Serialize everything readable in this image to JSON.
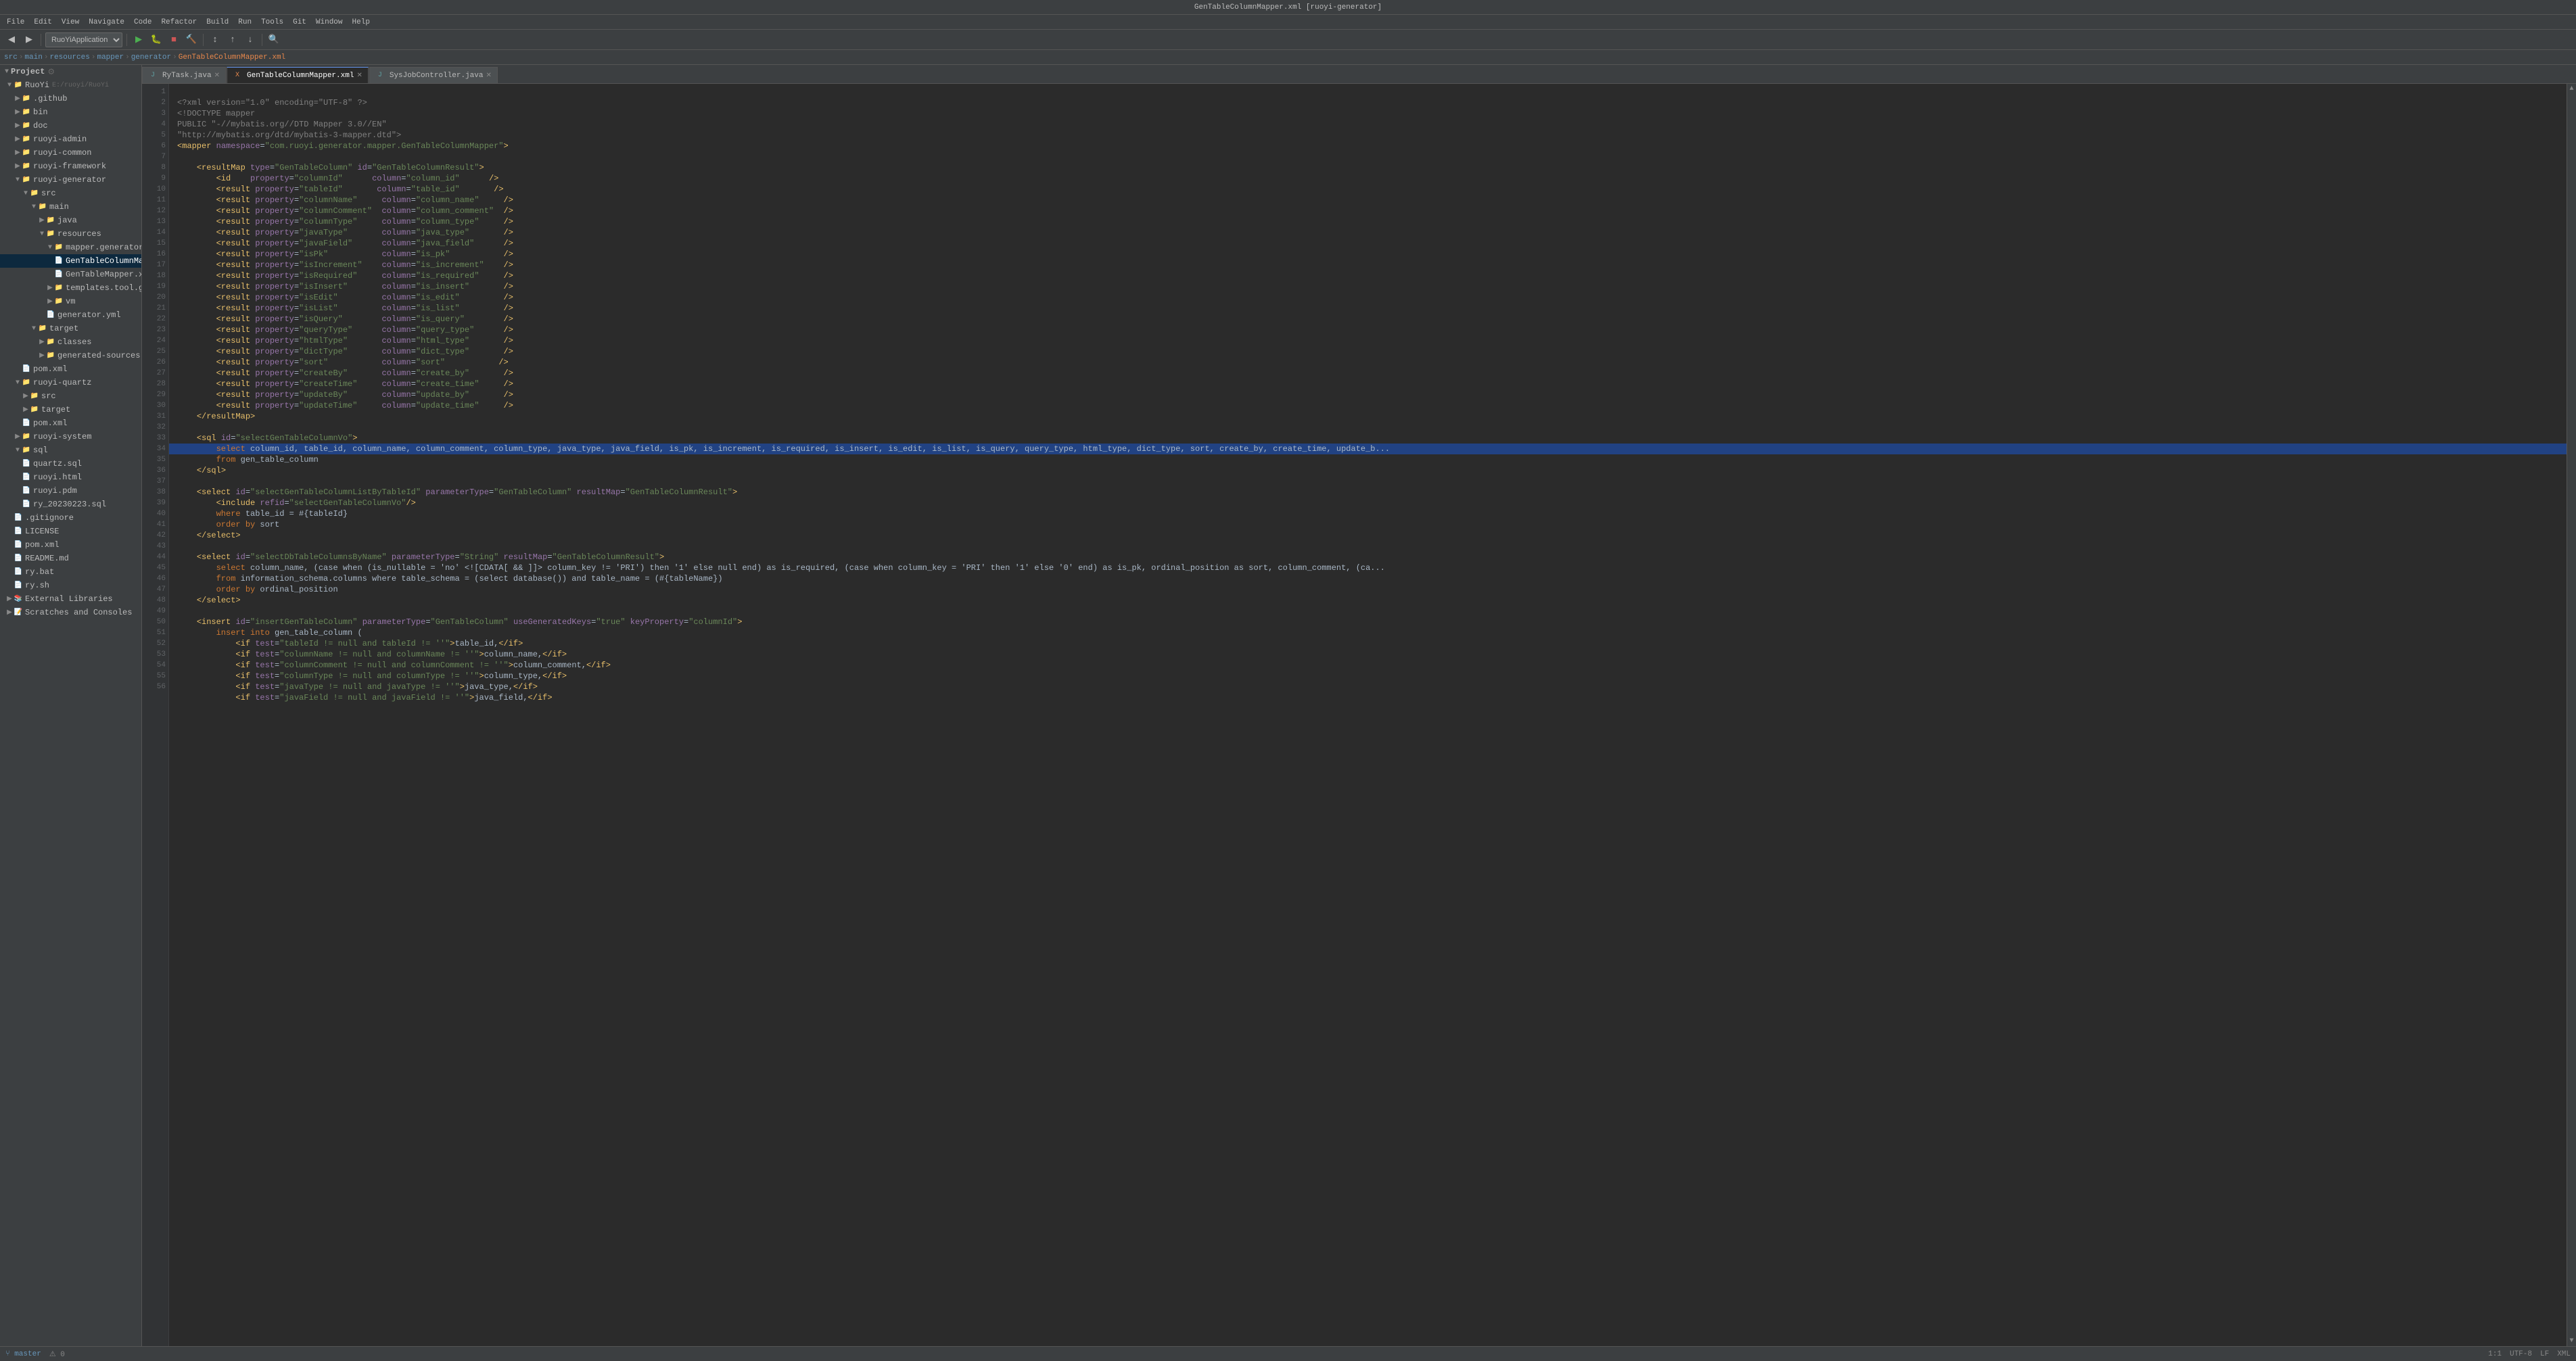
{
  "titleBar": {
    "text": "GenTableColumnMapper.xml [ruoyi-generator]"
  },
  "menuBar": {
    "items": [
      "File",
      "Edit",
      "View",
      "Navigate",
      "Code",
      "Refactor",
      "Build",
      "Run",
      "Tools",
      "Git",
      "Window",
      "Help"
    ]
  },
  "toolbar": {
    "appSelector": "RuoYiApplication",
    "runBtn": "▶",
    "debugBtn": "🐛",
    "stopBtn": "■"
  },
  "breadcrumb": {
    "parts": [
      "src",
      "main",
      "resources",
      "mapper",
      "generator",
      "GenTableColumnMapper.xml"
    ]
  },
  "tabs": [
    {
      "label": "RyTask.java",
      "active": false,
      "modified": false
    },
    {
      "label": "GenTableColumnMapper.xml",
      "active": true,
      "modified": false
    },
    {
      "label": "SysJobController.java",
      "active": false,
      "modified": false
    }
  ],
  "sidebar": {
    "project_label": "Project",
    "tree": [
      {
        "level": 0,
        "icon": "folder",
        "label": "RuoYi",
        "path": "E:/ruoyi/RuoYi",
        "expanded": true
      },
      {
        "level": 1,
        "icon": "folder",
        "label": "github",
        "expanded": false
      },
      {
        "level": 1,
        "icon": "folder",
        "label": "bin",
        "expanded": false
      },
      {
        "level": 1,
        "icon": "folder",
        "label": "doc",
        "expanded": false
      },
      {
        "level": 1,
        "icon": "folder",
        "label": "ruoyi-admin",
        "expanded": false
      },
      {
        "level": 1,
        "icon": "folder",
        "label": "ruoyi-common",
        "expanded": false
      },
      {
        "level": 1,
        "icon": "folder",
        "label": "ruoyi-framework",
        "expanded": false
      },
      {
        "level": 1,
        "icon": "folder",
        "label": "ruoyi-generator",
        "expanded": true
      },
      {
        "level": 2,
        "icon": "folder",
        "label": "src",
        "expanded": true
      },
      {
        "level": 3,
        "icon": "folder",
        "label": "main",
        "expanded": true
      },
      {
        "level": 4,
        "icon": "folder",
        "label": "java",
        "expanded": false
      },
      {
        "level": 4,
        "icon": "folder",
        "label": "resources",
        "expanded": true
      },
      {
        "level": 5,
        "icon": "folder",
        "label": "mapper.generator",
        "expanded": true
      },
      {
        "level": 6,
        "icon": "xml",
        "label": "GenTableColumnMapper.xml",
        "selected": true
      },
      {
        "level": 6,
        "icon": "xml",
        "label": "GenTableMapper.xml"
      },
      {
        "level": 5,
        "icon": "folder",
        "label": "templates.tool.gen",
        "expanded": false
      },
      {
        "level": 5,
        "icon": "folder",
        "label": "vm",
        "expanded": false
      },
      {
        "level": 5,
        "icon": "yml",
        "label": "generator.yml"
      },
      {
        "level": 2,
        "icon": "folder",
        "label": "target",
        "expanded": true
      },
      {
        "level": 3,
        "icon": "folder",
        "label": "classes",
        "expanded": false
      },
      {
        "level": 3,
        "icon": "folder",
        "label": "generated-sources",
        "expanded": false
      },
      {
        "level": 2,
        "icon": "pom",
        "label": "pom.xml"
      },
      {
        "level": 1,
        "icon": "folder",
        "label": "ruoyi-quartz",
        "expanded": true
      },
      {
        "level": 2,
        "icon": "folder",
        "label": "src",
        "expanded": false
      },
      {
        "level": 2,
        "icon": "folder",
        "label": "target",
        "expanded": false
      },
      {
        "level": 2,
        "icon": "pom",
        "label": "pom.xml"
      },
      {
        "level": 1,
        "icon": "folder",
        "label": "ruoyi-system",
        "expanded": false
      },
      {
        "level": 1,
        "icon": "folder",
        "label": "sql",
        "expanded": true
      },
      {
        "level": 2,
        "icon": "sql",
        "label": "quartz.sql"
      },
      {
        "level": 2,
        "icon": "html",
        "label": "ruoyi.html"
      },
      {
        "level": 2,
        "icon": "sql",
        "label": "ruoyi.pdm"
      },
      {
        "level": 2,
        "icon": "sql",
        "label": "ry_20230223.sql"
      },
      {
        "level": 1,
        "icon": "folder",
        "label": ".gitignore"
      },
      {
        "level": 1,
        "icon": "file",
        "label": "LICENSE"
      },
      {
        "level": 1,
        "icon": "pom",
        "label": "pom.xml"
      },
      {
        "level": 1,
        "icon": "file",
        "label": "README.md"
      },
      {
        "level": 1,
        "icon": "bat",
        "label": "ry.bat"
      },
      {
        "level": 1,
        "icon": "sh",
        "label": "ry.sh"
      },
      {
        "level": 0,
        "icon": "folder",
        "label": "External Libraries",
        "expanded": false
      },
      {
        "level": 0,
        "icon": "folder",
        "label": "Scratches and Consoles",
        "expanded": false
      }
    ]
  },
  "editor": {
    "filename": "GenTableColumnMapper.xml",
    "lines": [
      {
        "num": 1,
        "code": "<?xml version=\"1.0\" encoding=\"UTF-8\" ?>"
      },
      {
        "num": 2,
        "code": "<!DOCTYPE mapper"
      },
      {
        "num": 3,
        "code": "PUBLIC \"-//mybatis.org//DTD Mapper 3.0//EN\""
      },
      {
        "num": 4,
        "code": "\"http://mybatis.org/dtd/mybatis-3-mapper.dtd\">"
      },
      {
        "num": 5,
        "code": "<mapper namespace=\"com.ruoyi.generator.mapper.GenTableColumnMapper\">"
      },
      {
        "num": 6,
        "code": ""
      },
      {
        "num": 7,
        "code": "    <resultMap type=\"GenTableColumn\" id=\"GenTableColumnResult\">"
      },
      {
        "num": 8,
        "code": "        <id    property=\"columnId\"   column=\"column_id\"   />"
      },
      {
        "num": 9,
        "code": "        <result property=\"tableId\"    column=\"table_id\"    />"
      },
      {
        "num": 10,
        "code": "        <result property=\"columnName\"  column=\"column_name\"  />"
      },
      {
        "num": 11,
        "code": "        <result property=\"columnComment\" column=\"column_comment\" />"
      },
      {
        "num": 12,
        "code": "        <result property=\"columnType\"  column=\"column_type\"  />"
      },
      {
        "num": 13,
        "code": "        <result property=\"javaType\"   column=\"java_type\"   />"
      },
      {
        "num": 14,
        "code": "        <result property=\"javaField\"  column=\"java_field\"  />"
      },
      {
        "num": 15,
        "code": "        <result property=\"isPk\"      column=\"is_pk\"      />"
      },
      {
        "num": 16,
        "code": "        <result property=\"isIncrement\" column=\"is_increment\" />"
      },
      {
        "num": 17,
        "code": "        <result property=\"isRequired\" column=\"is_required\" />"
      },
      {
        "num": 18,
        "code": "        <result property=\"isInsert\"  column=\"is_insert\"  />"
      },
      {
        "num": 19,
        "code": "        <result property=\"isEdit\"    column=\"is_edit\"    />"
      },
      {
        "num": 20,
        "code": "        <result property=\"isList\"    column=\"is_list\"    />"
      },
      {
        "num": 21,
        "code": "        <result property=\"isQuery\"   column=\"is_query\"   />"
      },
      {
        "num": 22,
        "code": "        <result property=\"queryType\"  column=\"query_type\"  />"
      },
      {
        "num": 23,
        "code": "        <result property=\"htmlType\"  column=\"html_type\"  />"
      },
      {
        "num": 24,
        "code": "        <result property=\"dictType\"  column=\"dict_type\"  />"
      },
      {
        "num": 25,
        "code": "        <result property=\"sort\"      column=\"sort\"       />"
      },
      {
        "num": 26,
        "code": "        <result property=\"createBy\"  column=\"create_by\"  />"
      },
      {
        "num": 27,
        "code": "        <result property=\"createTime\" column=\"create_time\" />"
      },
      {
        "num": 28,
        "code": "        <result property=\"updateBy\"  column=\"update_by\"  />"
      },
      {
        "num": 29,
        "code": "        <result property=\"updateTime\" column=\"update_time\" />"
      },
      {
        "num": 30,
        "code": "    </resultMap>"
      },
      {
        "num": 31,
        "code": ""
      },
      {
        "num": 32,
        "code": "    <sql id=\"selectGenTableColumnVo\">"
      },
      {
        "num": 33,
        "code": "        select column_id, table_id, column_name, column_comment, column_type, java_type, java_field, is_pk, is_increment, is_required, is_insert, is_edit, is_list, is_query, query_type, html_type, dict_type, sort, create_by, create_time, update_b..."
      },
      {
        "num": 34,
        "code": "        from gen_table_column"
      },
      {
        "num": 35,
        "code": "    </sql>"
      },
      {
        "num": 36,
        "code": ""
      },
      {
        "num": 37,
        "code": "    <select id=\"selectGenTableColumnListByTableId\" parameterType=\"GenTableColumn\" resultMap=\"GenTableColumnResult\">"
      },
      {
        "num": 38,
        "code": "        <include refid=\"selectGenTableColumnVo\"/>"
      },
      {
        "num": 39,
        "code": "        where table_id = #{tableId}"
      },
      {
        "num": 40,
        "code": "        order by sort"
      },
      {
        "num": 41,
        "code": "    </select>"
      },
      {
        "num": 42,
        "code": ""
      },
      {
        "num": 43,
        "code": "    <select id=\"selectDbTableColumnsByName\" parameterType=\"String\" resultMap=\"GenTableColumnResult\">"
      },
      {
        "num": 44,
        "code": "        select column_name, (case when (is_nullable = 'no' <![CDATA[ && ]]> column_key != 'PRI') then '1' else null end) as is_required, (case when column_key = 'PRI' then '1' else '0' end) as is_pk, ordinal_position as sort, column_comment, (ca..."
      },
      {
        "num": 45,
        "code": "        from information_schema.columns where table_schema = (select database()) and table_name = (#{tableName})"
      },
      {
        "num": 46,
        "code": "        order by ordinal_position"
      },
      {
        "num": 47,
        "code": "    </select>"
      },
      {
        "num": 48,
        "code": ""
      },
      {
        "num": 49,
        "code": "    <insert id=\"insertGenTableColumn\" parameterType=\"GenTableColumn\" useGeneratedKeys=\"true\" keyProperty=\"columnId\">"
      },
      {
        "num": 50,
        "code": "        insert into gen_table_column ("
      },
      {
        "num": 51,
        "code": "            <if test=\"tableId != null and tableId != ''\">table_id,</if>"
      },
      {
        "num": 52,
        "code": "            <if test=\"columnName != null and columnName != ''\">column_name,</if>"
      },
      {
        "num": 53,
        "code": "            <if test=\"columnComment != null and columnComment != ''\">column_comment,</if>"
      },
      {
        "num": 54,
        "code": "            <if test=\"columnType != null and columnType != ''\">column_type,</if>"
      },
      {
        "num": 55,
        "code": "            <if test=\"javaType != null and javaType != ''\">java_type,</if>"
      },
      {
        "num": 56,
        "code": "            <if test=\"javaField != null and javaField != ''\">java_field,</if>"
      }
    ]
  },
  "statusBar": {
    "encoding": "UTF-8",
    "lineEnding": "LF",
    "language": "XML",
    "position": "1:1"
  }
}
